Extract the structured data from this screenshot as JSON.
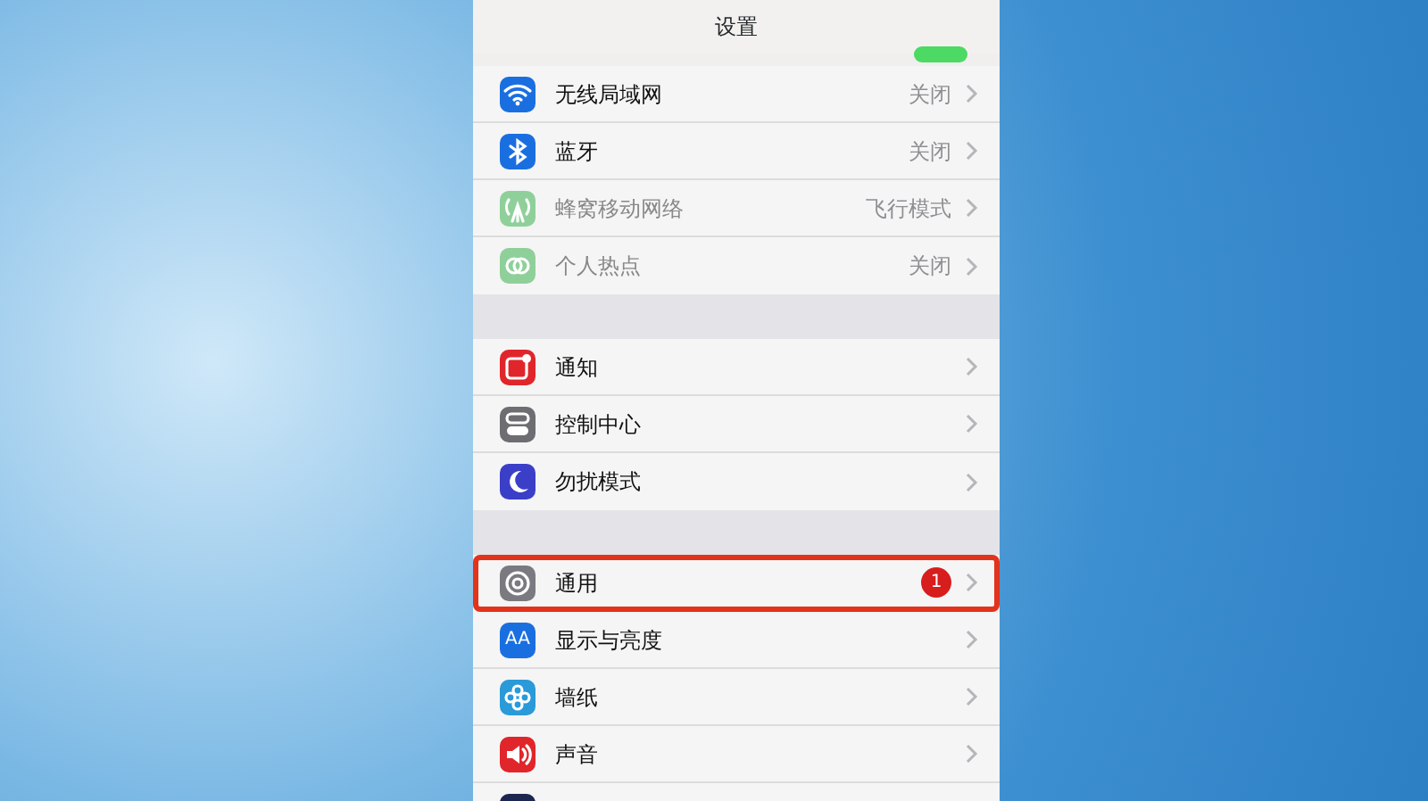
{
  "header": {
    "title": "设置"
  },
  "airplane_toggle": {
    "on": true
  },
  "groups": [
    {
      "items": [
        {
          "kind": "wifi",
          "color": "#1a6fe0",
          "label": "无线局域网",
          "value": "关闭",
          "disabled": false,
          "highlighted": false
        },
        {
          "kind": "bluetooth",
          "color": "#1a6fe0",
          "label": "蓝牙",
          "value": "关闭",
          "disabled": false,
          "highlighted": false
        },
        {
          "kind": "antenna",
          "color": "#8fd09a",
          "label": "蜂窝移动网络",
          "value": "飞行模式",
          "disabled": true,
          "highlighted": false
        },
        {
          "kind": "link",
          "color": "#8fd09a",
          "label": "个人热点",
          "value": "关闭",
          "disabled": true,
          "highlighted": false
        }
      ]
    },
    {
      "items": [
        {
          "kind": "notice",
          "color": "#e0262a",
          "label": "通知",
          "disabled": false,
          "highlighted": false
        },
        {
          "kind": "switches",
          "color": "#6d6d72",
          "label": "控制中心",
          "disabled": false,
          "highlighted": false
        },
        {
          "kind": "moon",
          "color": "#3b3fc8",
          "label": "勿扰模式",
          "disabled": false,
          "highlighted": false
        }
      ]
    },
    {
      "items": [
        {
          "kind": "gear",
          "color": "#7a7a80",
          "label": "通用",
          "badge": "1",
          "disabled": false,
          "highlighted": true
        },
        {
          "kind": "text",
          "icon_text": "AA",
          "color": "#1a6fe0",
          "label": "显示与亮度",
          "disabled": false,
          "highlighted": false
        },
        {
          "kind": "flower",
          "color": "#2a9ad8",
          "label": "墙纸",
          "disabled": false,
          "highlighted": false
        },
        {
          "kind": "speaker",
          "color": "#e0262a",
          "label": "声音",
          "disabled": false,
          "highlighted": false
        },
        {
          "kind": "blank",
          "color": "#1c2650"
        }
      ]
    }
  ]
}
